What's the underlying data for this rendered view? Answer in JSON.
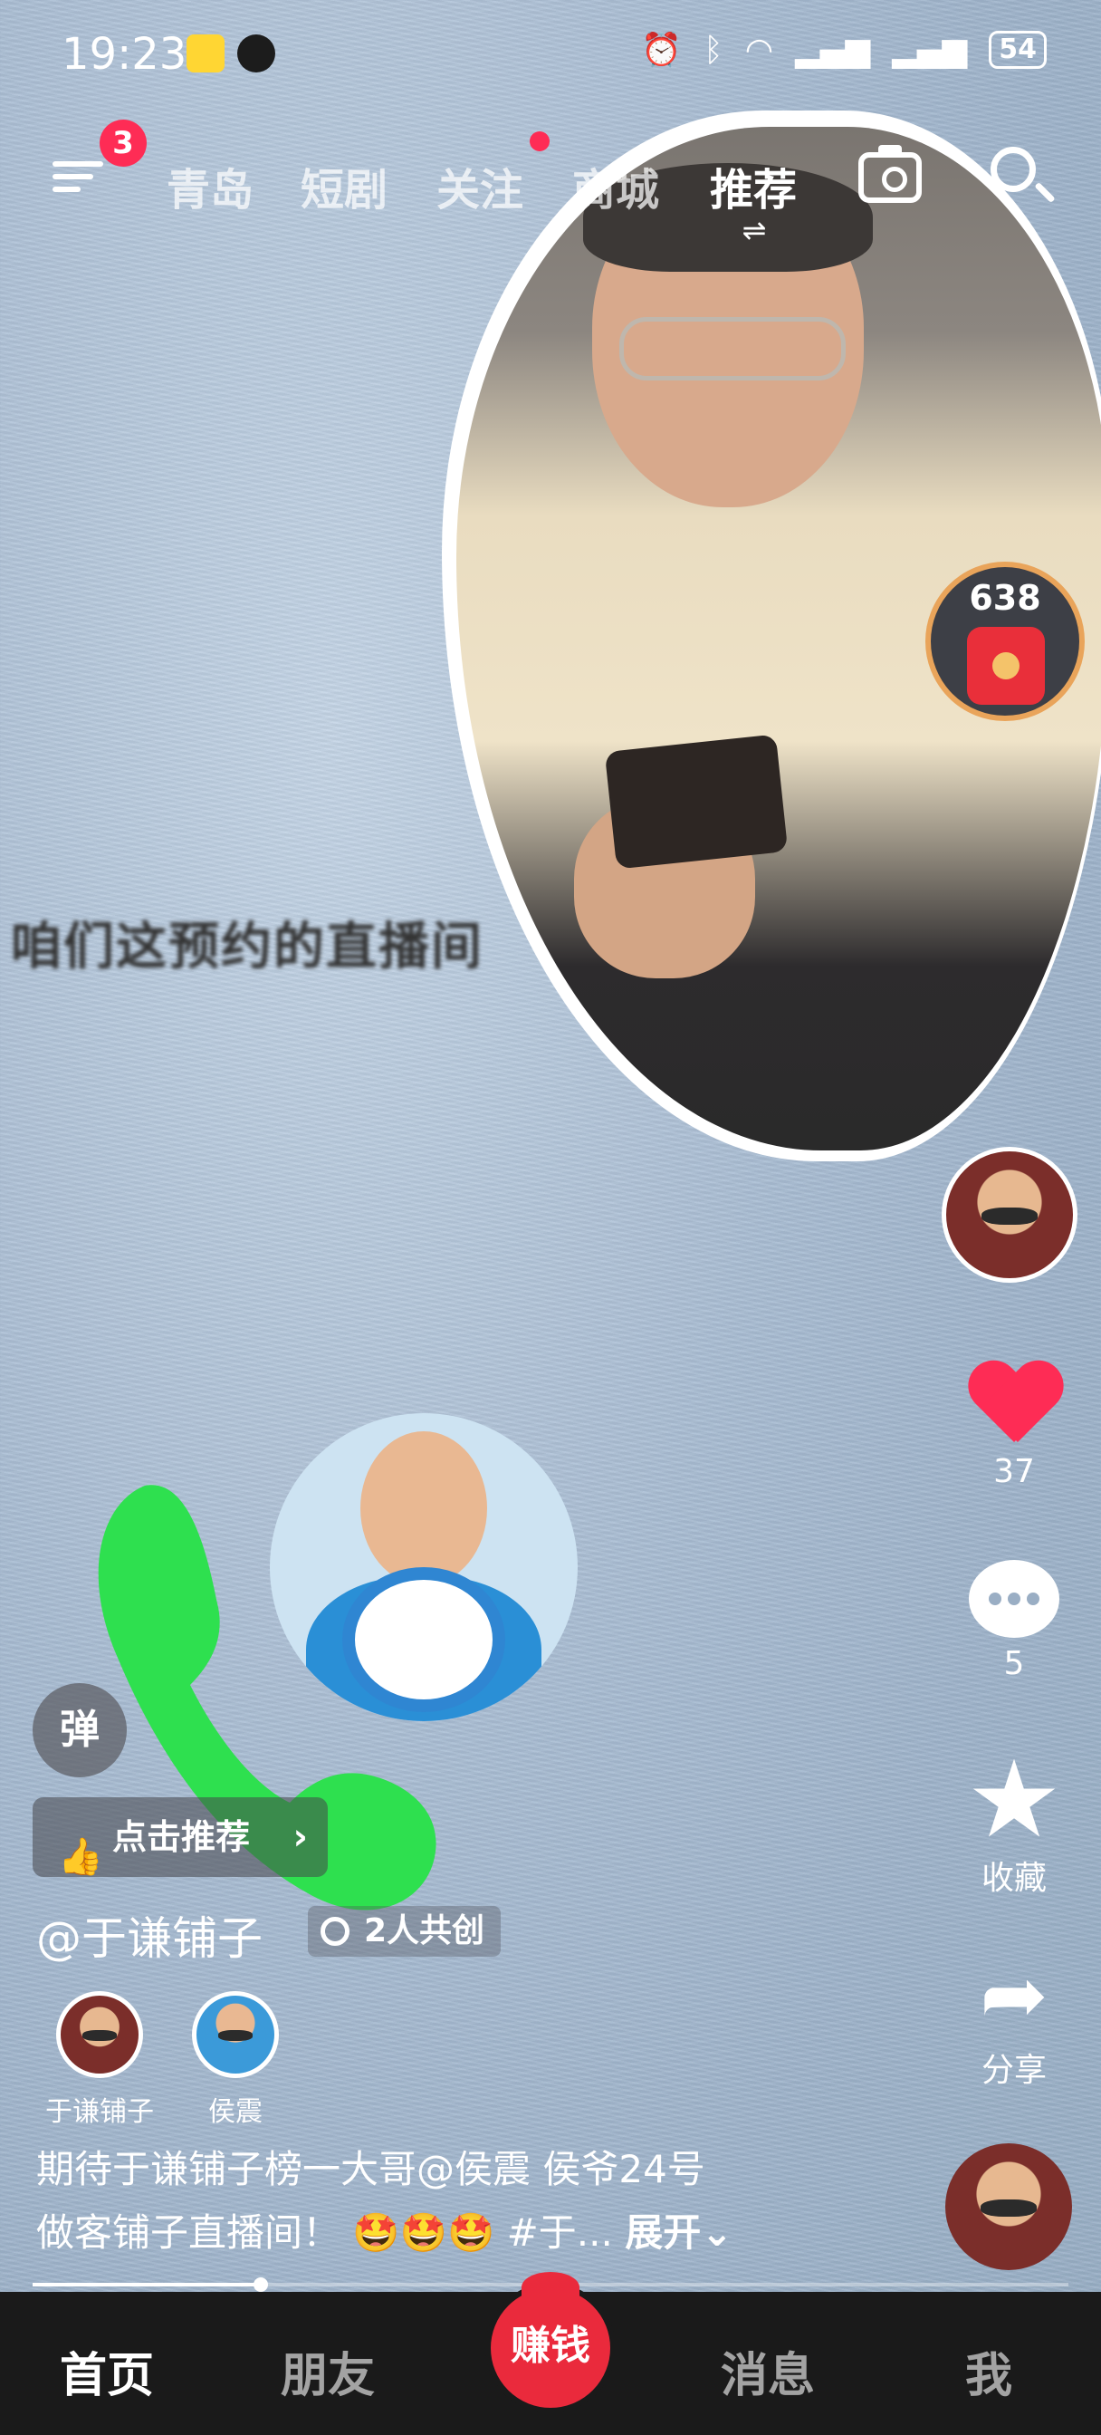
{
  "status_bar": {
    "time": "19:23",
    "battery": "54"
  },
  "top_nav": {
    "menu_badge": "3",
    "tabs": [
      {
        "label": "青岛"
      },
      {
        "label": "短剧"
      },
      {
        "label": "关注"
      },
      {
        "label": "商城"
      },
      {
        "label": "推荐"
      }
    ],
    "tab_switch_glyph": "⇌"
  },
  "video": {
    "subtitle": "咱们这预约的直播间"
  },
  "red_packet": {
    "count": "638"
  },
  "right_rail": {
    "likes": "37",
    "comments": "5",
    "favorite_label": "收藏",
    "share_label": "分享"
  },
  "info": {
    "danmu_label": "弹",
    "recommend_label": "点击推荐",
    "author": "@于谦铺子",
    "cocreate_label": "2人共创",
    "creators": [
      {
        "name": "于谦铺子"
      },
      {
        "name": "侯震"
      }
    ],
    "caption_line1": "期待于谦铺子榜一大哥@侯震 侯爷24号",
    "caption_line2": "做客铺子直播间！ 🤩🤩🤩 #于...",
    "expand_label": "展开⌄"
  },
  "progress": {
    "fraction": 0.22
  },
  "bottom_nav": {
    "home": "首页",
    "friends": "朋友",
    "earn": "赚钱",
    "messages": "消息",
    "me": "我"
  },
  "colors": {
    "accent": "#fe2c55",
    "earn": "#ea2a3c",
    "green_sticker": "#2ee04f"
  }
}
